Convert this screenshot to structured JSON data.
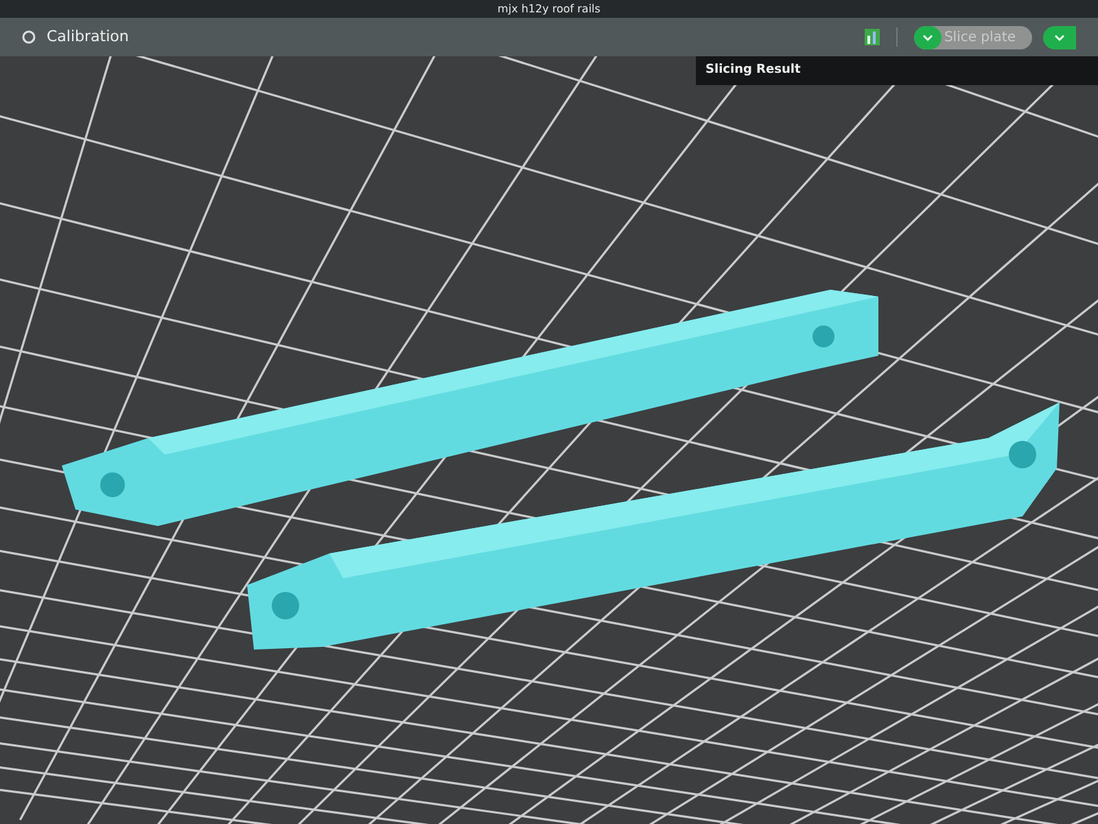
{
  "window": {
    "title": "mjx h12y roof rails"
  },
  "toolbar": {
    "calibration": "Calibration",
    "slice_button": {
      "label": "Slice plate",
      "disabled": true
    }
  },
  "slicing_result": {
    "title": "Slicing Result"
  }
}
